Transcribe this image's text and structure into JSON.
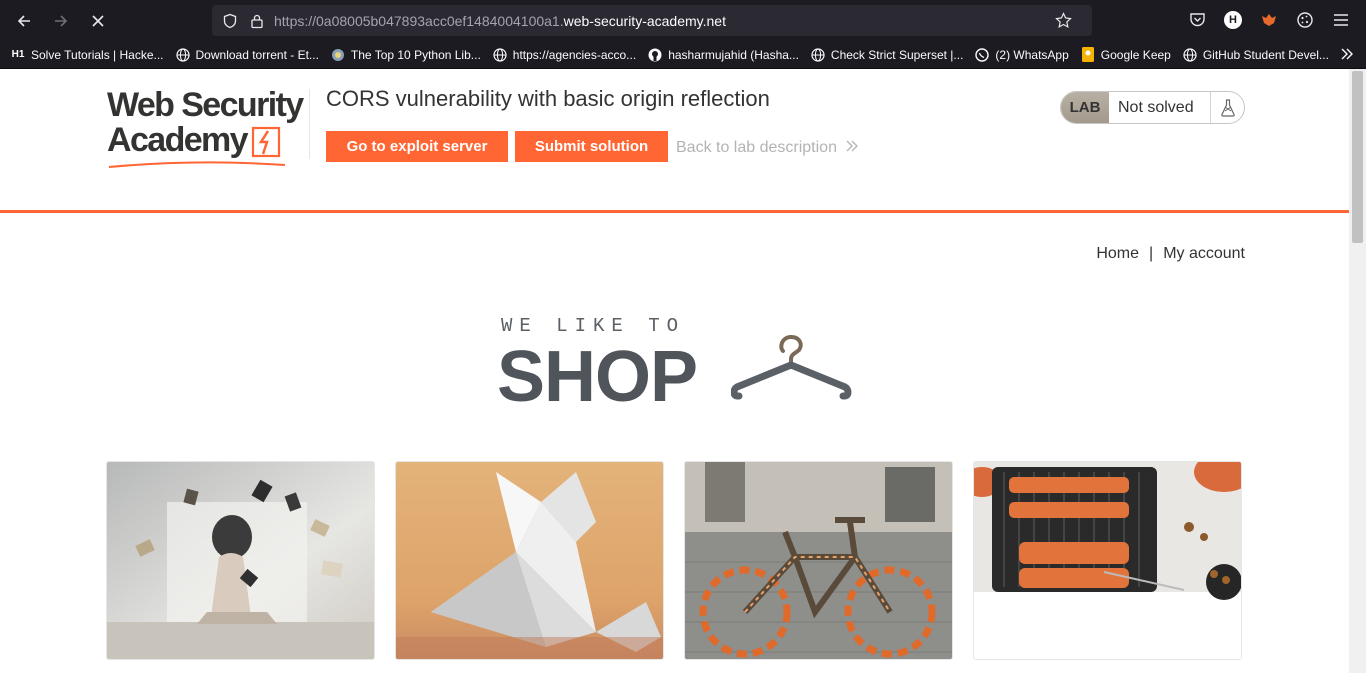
{
  "browser": {
    "url_prefix": "https://0a08005b047893acc0ef1484004100a1.",
    "url_domain": "web-security-academy.net",
    "avatar_letter": "H",
    "bookmarks": [
      {
        "icon": "hackerone-icon",
        "label": "Solve Tutorials | Hacke..."
      },
      {
        "icon": "globe-icon",
        "label": "Download torrent - Et..."
      },
      {
        "icon": "python-icon",
        "label": "The Top 10 Python Lib..."
      },
      {
        "icon": "globe-icon",
        "label": "https://agencies-acco..."
      },
      {
        "icon": "github-icon",
        "label": "hasharmujahid (Hasha..."
      },
      {
        "icon": "globe-icon",
        "label": "Check Strict Superset |..."
      },
      {
        "icon": "whatsapp-icon",
        "label": "(2) WhatsApp"
      },
      {
        "icon": "keep-icon",
        "label": "Google Keep"
      },
      {
        "icon": "globe-icon",
        "label": "GitHub Student Devel..."
      }
    ]
  },
  "header": {
    "logo_line1": "Web Security",
    "logo_line2": "Academy",
    "title": "CORS vulnerability with basic origin reflection",
    "exploit_button": "Go to exploit server",
    "submit_button": "Submit solution",
    "back_link": "Back to lab description",
    "lab_badge": "LAB",
    "status": "Not solved"
  },
  "nav": {
    "home": "Home",
    "separator": "|",
    "account": "My account"
  },
  "hero": {
    "tagline": "WE LIKE TO",
    "headline": "SHOP"
  },
  "products": [
    {
      "image": "woman-flying-books-photo"
    },
    {
      "image": "paper-origami-photo"
    },
    {
      "image": "knitted-bicycle-photo"
    },
    {
      "image": "grill-skewers-photo"
    }
  ],
  "colors": {
    "accent": "#ff6633",
    "chrome_bg": "#1c1b22",
    "urlbar_bg": "#2b2a33"
  }
}
